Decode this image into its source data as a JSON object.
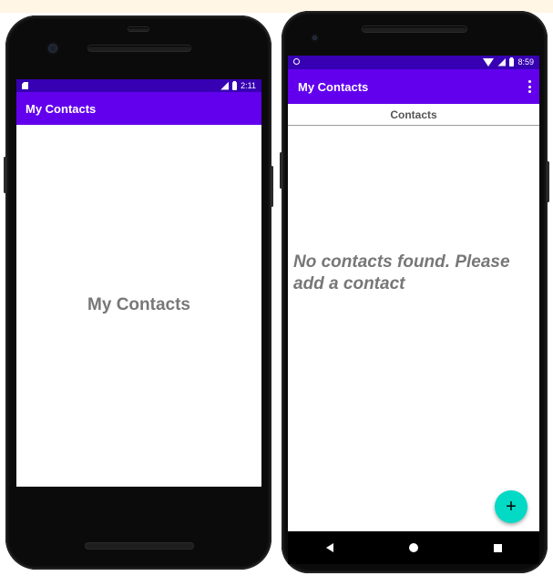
{
  "left_phone": {
    "status_time": "2:11",
    "app_title": "My Contacts",
    "center_label": "My Contacts"
  },
  "right_phone": {
    "status_time": "8:59",
    "app_title": "My Contacts",
    "tab_label": "Contacts",
    "empty_message": "No contacts found. Please add a contact",
    "fab_label": "+"
  },
  "colors": {
    "primary": "#6200ee",
    "primary_dark": "#3700b3",
    "accent": "#03dac5",
    "device_body": "#0b0b0b"
  },
  "icons": {
    "status_left_phone1": "sd-card-icon",
    "status_left_phone2": "circle-icon",
    "status_right": [
      "wifi-icon",
      "signal-icon",
      "battery-icon"
    ],
    "navigation": [
      "back-icon",
      "home-icon",
      "recents-icon"
    ],
    "menu": "overflow-menu-icon",
    "fab": "add-icon"
  }
}
